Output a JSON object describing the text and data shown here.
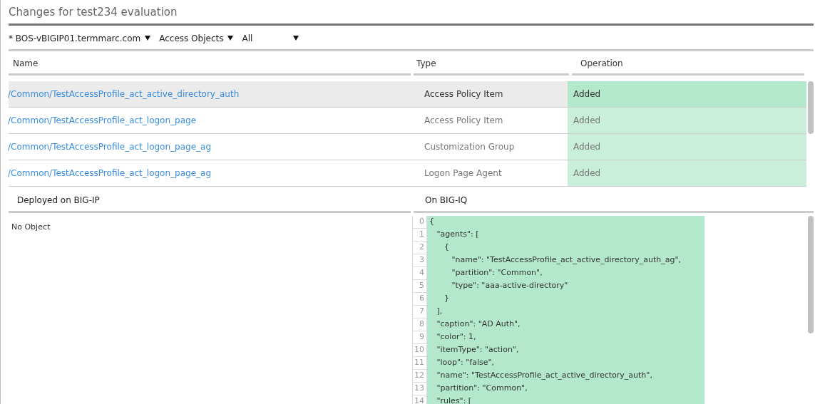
{
  "title": "Changes for test234 evaluation",
  "filters": [
    {
      "label": "* BOS-vBIGIP01.termmarc.com"
    },
    {
      "label": "Access Objects"
    },
    {
      "label": "All"
    }
  ],
  "table": {
    "columns": [
      "Name",
      "Type",
      "Operation"
    ],
    "rows": [
      {
        "name": "/Common/TestAccessProfile_act_active_directory_auth",
        "type": "Access Policy Item",
        "operation": "Added",
        "selected": true
      },
      {
        "name": "/Common/TestAccessProfile_act_logon_page",
        "type": "Access Policy Item",
        "operation": "Added",
        "selected": false
      },
      {
        "name": "/Common/TestAccessProfile_act_logon_page_ag",
        "type": "Customization Group",
        "operation": "Added",
        "selected": false
      },
      {
        "name": "/Common/TestAccessProfile_act_logon_page_ag",
        "type": "Logon Page Agent",
        "operation": "Added",
        "selected": false
      }
    ]
  },
  "deployed": {
    "heading": "Deployed on BIG-IP",
    "text": "No Object"
  },
  "bigiq": {
    "heading": "On BIG-IQ",
    "lines": [
      {
        "number": "0",
        "text": "{"
      },
      {
        "number": "1",
        "text": "   \"agents\": ["
      },
      {
        "number": "2",
        "text": "      {"
      },
      {
        "number": "3",
        "text": "         \"name\": \"TestAccessProfile_act_active_directory_auth_ag\","
      },
      {
        "number": "4",
        "text": "         \"partition\": \"Common\","
      },
      {
        "number": "5",
        "text": "         \"type\": \"aaa-active-directory\""
      },
      {
        "number": "6",
        "text": "      }"
      },
      {
        "number": "7",
        "text": "   ],"
      },
      {
        "number": "8",
        "text": "   \"caption\": \"AD Auth\","
      },
      {
        "number": "9",
        "text": "   \"color\": 1,"
      },
      {
        "number": "10",
        "text": "   \"itemType\": \"action\","
      },
      {
        "number": "11",
        "text": "   \"loop\": \"false\","
      },
      {
        "number": "12",
        "text": "   \"name\": \"TestAccessProfile_act_active_directory_auth\","
      },
      {
        "number": "13",
        "text": "   \"partition\": \"Common\","
      },
      {
        "number": "14",
        "text": "   \"rules\": ["
      }
    ]
  }
}
